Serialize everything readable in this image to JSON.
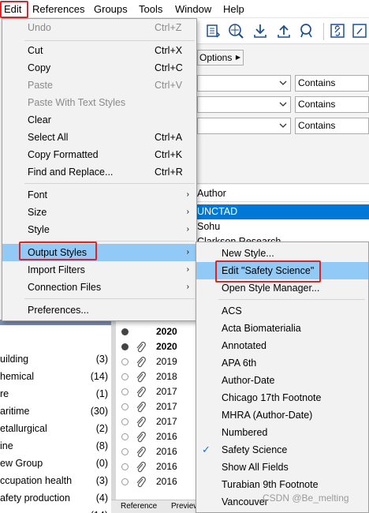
{
  "menubar": {
    "items": [
      "Edit",
      "References",
      "Groups",
      "Tools",
      "Window",
      "Help"
    ]
  },
  "search": {
    "options_label": "Options",
    "rows": [
      {
        "operator": "Contains"
      },
      {
        "operator": "Contains"
      },
      {
        "operator": "Contains"
      }
    ]
  },
  "references": {
    "column_header": "Author",
    "rows": [
      {
        "text": "UNCTAD",
        "selected": true
      },
      {
        "text": "Sohu",
        "selected": false
      },
      {
        "text": "Clarkson Research",
        "selected": false
      }
    ]
  },
  "groups": [
    {
      "name": "uilding",
      "count": "(3)"
    },
    {
      "name": "hemical",
      "count": "(14)"
    },
    {
      "name": "re",
      "count": "(1)"
    },
    {
      "name": "aritime",
      "count": "(30)"
    },
    {
      "name": "etallurgical",
      "count": "(2)"
    },
    {
      "name": "ine",
      "count": "(8)"
    },
    {
      "name": "ew Group",
      "count": "(0)"
    },
    {
      "name": "ccupation health",
      "count": "(3)"
    },
    {
      "name": "afety production",
      "count": "(4)"
    },
    {
      "name": "",
      "count": "(14)"
    }
  ],
  "years": [
    {
      "value": "2020",
      "read": true,
      "bold": true,
      "attachment": false
    },
    {
      "value": "2020",
      "read": true,
      "bold": true,
      "attachment": true
    },
    {
      "value": "2019",
      "read": false,
      "bold": false,
      "attachment": true
    },
    {
      "value": "2018",
      "read": false,
      "bold": false,
      "attachment": true
    },
    {
      "value": "2017",
      "read": false,
      "bold": false,
      "attachment": true
    },
    {
      "value": "2017",
      "read": false,
      "bold": false,
      "attachment": true
    },
    {
      "value": "2017",
      "read": false,
      "bold": false,
      "attachment": true
    },
    {
      "value": "2016",
      "read": false,
      "bold": false,
      "attachment": true
    },
    {
      "value": "2016",
      "read": false,
      "bold": false,
      "attachment": true
    },
    {
      "value": "2016",
      "read": false,
      "bold": false,
      "attachment": true
    },
    {
      "value": "2016",
      "read": false,
      "bold": false,
      "attachment": true
    }
  ],
  "bottom_tabs": [
    "Reference",
    "Preview"
  ],
  "edit_menu": {
    "items": [
      {
        "label": "Undo",
        "shortcut": "Ctrl+Z",
        "disabled": true
      },
      {
        "label": "Cut",
        "shortcut": "Ctrl+X",
        "disabled": false
      },
      {
        "label": "Copy",
        "shortcut": "Ctrl+C",
        "disabled": false
      },
      {
        "label": "Paste",
        "shortcut": "Ctrl+V",
        "disabled": true
      },
      {
        "label": "Paste With Text Styles",
        "shortcut": "",
        "disabled": true
      },
      {
        "label": "Clear",
        "shortcut": "",
        "disabled": false
      },
      {
        "label": "Select All",
        "shortcut": "Ctrl+A",
        "disabled": false
      },
      {
        "label": "Copy Formatted",
        "shortcut": "Ctrl+K",
        "disabled": false
      },
      {
        "label": "Find and Replace...",
        "shortcut": "Ctrl+R",
        "disabled": false
      },
      {
        "label": "Font",
        "submenu": true
      },
      {
        "label": "Size",
        "submenu": true
      },
      {
        "label": "Style",
        "submenu": true
      },
      {
        "label": "Output Styles",
        "submenu": true,
        "highlighted": true
      },
      {
        "label": "Import Filters",
        "submenu": true
      },
      {
        "label": "Connection Files",
        "submenu": true
      },
      {
        "label": "Preferences..."
      }
    ]
  },
  "output_styles_menu": {
    "actions": [
      "New Style...",
      "Edit \"Safety Science\"",
      "Open Style Manager..."
    ],
    "styles": [
      "ACS",
      "Acta Biomaterialia",
      "Annotated",
      "APA 6th",
      "Author-Date",
      "Chicago 17th Footnote",
      "MHRA (Author-Date)",
      "Numbered",
      "Safety Science",
      "Show All Fields",
      "Turabian 9th Footnote",
      "Vancouver"
    ],
    "checked": "Safety Science"
  },
  "watermark": "CSDN @Be_melting",
  "colors": {
    "highlight_blue": "#91c9f7",
    "selection_blue": "#0078d7",
    "annotation_red": "#e02424"
  }
}
